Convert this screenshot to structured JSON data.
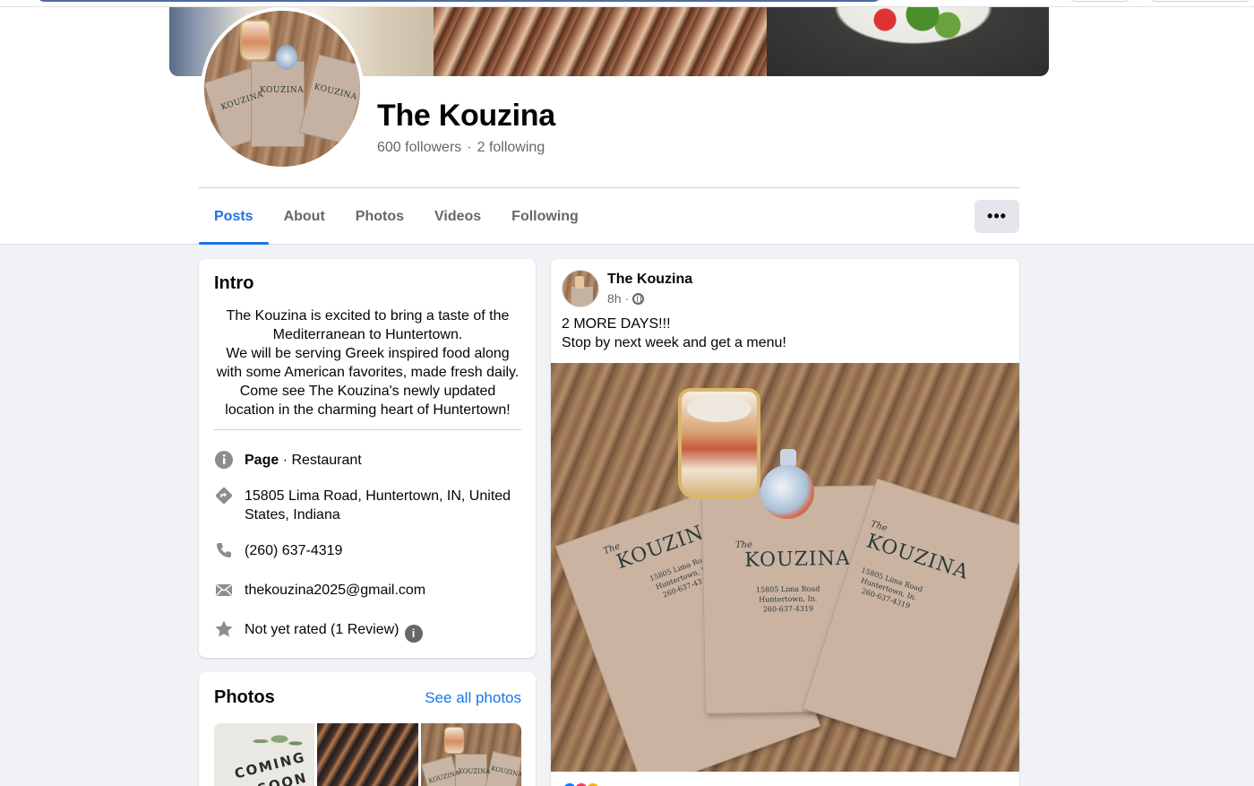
{
  "profile": {
    "name": "The Kouzina",
    "followers": "600 followers",
    "separator": "·",
    "following": "2 following"
  },
  "tabs": [
    {
      "label": "Posts",
      "active": true
    },
    {
      "label": "About"
    },
    {
      "label": "Photos"
    },
    {
      "label": "Videos"
    },
    {
      "label": "Following"
    }
  ],
  "more_button": "•••",
  "intro": {
    "title": "Intro",
    "bio": "The Kouzina is excited to bring a taste of the Mediterranean to Huntertown.\nWe will be serving Greek inspired food along with some American favorites, made fresh daily.\nCome see The Kouzina's newly updated location in the charming heart of Huntertown!",
    "page_label": "Page",
    "page_category": " · Restaurant",
    "address": "15805 Lima Road, Huntertown, IN, United States, Indiana",
    "phone": "(260) 637-4319",
    "email": "thekouzina2025@gmail.com",
    "rating": "Not yet rated (1 Review)",
    "info_glyph": "i",
    "icons": [
      "info-icon",
      "directions-icon",
      "phone-icon",
      "mail-icon",
      "star-icon"
    ]
  },
  "photos_card": {
    "title": "Photos",
    "see_all": "See all photos",
    "thumb1_line1": "COMING",
    "thumb1_line2": "SOON",
    "menu_word": "KOUZINA"
  },
  "post": {
    "author": "The Kouzina",
    "time": "8h",
    "dot": "·",
    "text": "2 MORE DAYS!!!\nStop by next week and get a menu!",
    "menu_brand": "KOUZINA",
    "menu_the": "The",
    "menu_address": "15805 Lima Road\nHuntertown, In.\n260-637-4319",
    "reaction_colors": [
      "#1877f2",
      "#f33e58",
      "#f7b125"
    ]
  },
  "colors": {
    "accent": "#1b74e4",
    "background": "#f0f2f5",
    "secondary_text": "#65676b"
  }
}
